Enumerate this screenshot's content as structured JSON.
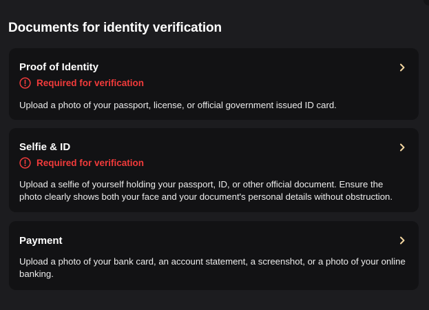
{
  "page": {
    "title": "Documents for identity verification"
  },
  "documents": [
    {
      "title": "Proof of Identity",
      "status": "Required for verification",
      "description": "Upload a photo of your passport, license, or official government issued ID card."
    },
    {
      "title": "Selfie & ID",
      "status": "Required for verification",
      "description": "Upload a selfie of yourself holding your passport, ID, or other official document. Ensure the photo clearly shows both your face and your document's personal details without obstruction."
    },
    {
      "title": "Payment",
      "description": "Upload a photo of your bank card, an account statement, a screenshot, or a photo of your online banking."
    }
  ],
  "colors": {
    "background": "#1c1c1f",
    "card": "#121214",
    "required": "#f23b3b",
    "chevron": "#f5d7a1"
  },
  "icons": {
    "status": "exclamation-circle-icon",
    "open": "chevron-right-icon"
  }
}
